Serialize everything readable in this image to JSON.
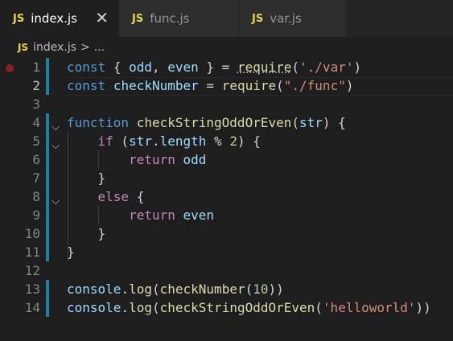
{
  "tabs": [
    {
      "badge": "JS",
      "label": "index.js",
      "close": "✕"
    },
    {
      "badge": "JS",
      "label": "func.js"
    },
    {
      "badge": "JS",
      "label": "var.js"
    }
  ],
  "breadcrumb": {
    "badge": "JS",
    "file": "index.js",
    "separator": ">",
    "rest": "..."
  },
  "editor": {
    "lines": [
      {
        "n": "1",
        "tokens": [
          [
            "kw",
            "const"
          ],
          [
            "p",
            " { "
          ],
          [
            "var",
            "odd"
          ],
          [
            "p",
            ", "
          ],
          [
            "var",
            "even"
          ],
          [
            "p",
            " } = "
          ],
          [
            "fn req",
            "require"
          ],
          [
            "p",
            "("
          ],
          [
            "str",
            "'./var'"
          ],
          [
            "p",
            ")"
          ]
        ]
      },
      {
        "n": "2",
        "tokens": [
          [
            "kw",
            "const"
          ],
          [
            "p",
            " "
          ],
          [
            "var",
            "checkNumber"
          ],
          [
            "p",
            " = "
          ],
          [
            "fn",
            "require"
          ],
          [
            "p",
            "("
          ],
          [
            "str",
            "\"./func\""
          ],
          [
            "p",
            ")"
          ]
        ]
      },
      {
        "n": "3",
        "tokens": []
      },
      {
        "n": "4",
        "tokens": [
          [
            "kw",
            "function"
          ],
          [
            "p",
            " "
          ],
          [
            "fn",
            "checkStringOddOrEven"
          ],
          [
            "p",
            "("
          ],
          [
            "var",
            "str"
          ],
          [
            "p",
            ") {"
          ]
        ]
      },
      {
        "n": "5",
        "tokens": [
          [
            "p",
            "    "
          ],
          [
            "ctl",
            "if"
          ],
          [
            "p",
            " ("
          ],
          [
            "var",
            "str"
          ],
          [
            "p",
            "."
          ],
          [
            "var",
            "length"
          ],
          [
            "p",
            " % "
          ],
          [
            "num",
            "2"
          ],
          [
            "p",
            ") {"
          ]
        ]
      },
      {
        "n": "6",
        "tokens": [
          [
            "p",
            "        "
          ],
          [
            "ctl",
            "return"
          ],
          [
            "p",
            " "
          ],
          [
            "var",
            "odd"
          ]
        ]
      },
      {
        "n": "7",
        "tokens": [
          [
            "p",
            "    }"
          ]
        ]
      },
      {
        "n": "8",
        "tokens": [
          [
            "p",
            "    "
          ],
          [
            "ctl",
            "else"
          ],
          [
            "p",
            " {"
          ]
        ]
      },
      {
        "n": "9",
        "tokens": [
          [
            "p",
            "        "
          ],
          [
            "ctl",
            "return"
          ],
          [
            "p",
            " "
          ],
          [
            "var",
            "even"
          ]
        ]
      },
      {
        "n": "10",
        "tokens": [
          [
            "p",
            "    }"
          ]
        ]
      },
      {
        "n": "11",
        "tokens": [
          [
            "p",
            "}"
          ]
        ]
      },
      {
        "n": "12",
        "tokens": []
      },
      {
        "n": "13",
        "tokens": [
          [
            "var",
            "console"
          ],
          [
            "p",
            "."
          ],
          [
            "fn",
            "log"
          ],
          [
            "p",
            "("
          ],
          [
            "fn",
            "checkNumber"
          ],
          [
            "p",
            "("
          ],
          [
            "num",
            "10"
          ],
          [
            "p",
            "))"
          ]
        ]
      },
      {
        "n": "14",
        "tokens": [
          [
            "var",
            "console"
          ],
          [
            "p",
            "."
          ],
          [
            "fn",
            "log"
          ],
          [
            "p",
            "("
          ],
          [
            "fn",
            "checkStringOddOrEven"
          ],
          [
            "p",
            "("
          ],
          [
            "str",
            "'helloworld'"
          ],
          [
            "p",
            "))"
          ]
        ]
      }
    ]
  },
  "colors": {
    "background": "#1e1e1e",
    "tab_inactive": "#2d2d2d",
    "keyword": "#569cd6",
    "function": "#dcdcaa",
    "variable": "#9cdcfe",
    "string": "#ce9178",
    "number": "#b5cea8",
    "control": "#c586c0",
    "js_badge": "#e8d44d",
    "gutter_modified": "#1b81a8",
    "breakpoint": "#8b1f1f"
  },
  "icons": {
    "fold": "chevron-down-icon",
    "close": "close-icon",
    "breakpoint": "breakpoint-icon",
    "file": "js-file-icon"
  }
}
